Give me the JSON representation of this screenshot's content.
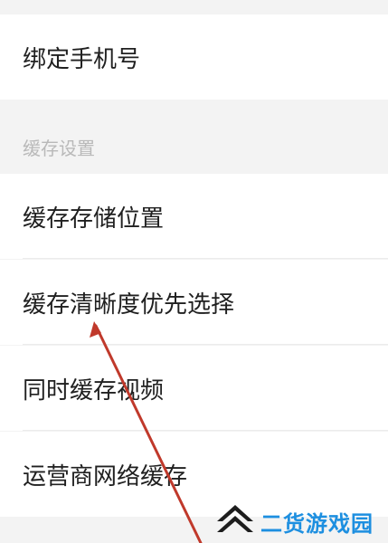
{
  "settings": {
    "bind_phone_label": "绑定手机号",
    "cache_section_title": "缓存设置",
    "items": [
      {
        "label": "缓存存储位置"
      },
      {
        "label": "缓存清晰度优先选择"
      },
      {
        "label": "同时缓存视频"
      },
      {
        "label": "运营商网络缓存"
      }
    ]
  },
  "annotation": {
    "arrow_color": "#c0392b"
  },
  "watermark": {
    "text": "二货游戏园",
    "color": "#1d8fe0"
  }
}
